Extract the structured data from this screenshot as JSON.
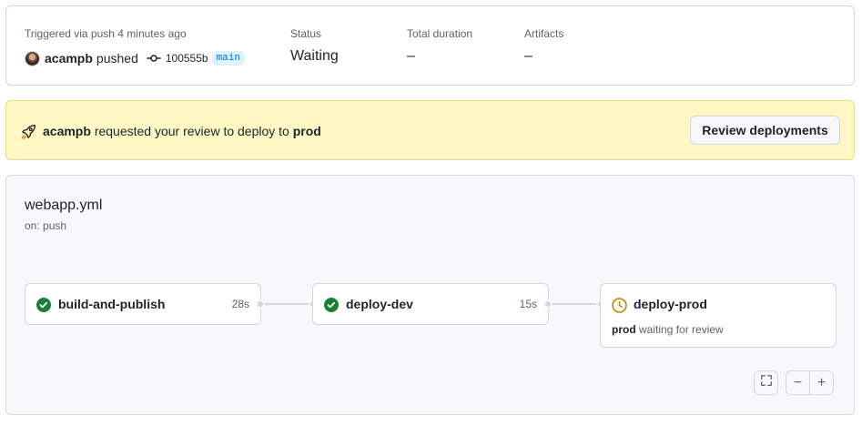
{
  "summary": {
    "trigger_label": "Triggered via push 4 minutes ago",
    "actor": "acampb",
    "action": "pushed",
    "commit_sha": "100555b",
    "branch": "main",
    "status_label": "Status",
    "status_value": "Waiting",
    "duration_label": "Total duration",
    "duration_value": "–",
    "artifacts_label": "Artifacts",
    "artifacts_value": "–"
  },
  "banner": {
    "actor": "acampb",
    "text_middle": "requested your review to deploy to",
    "environment": "prod",
    "button_label": "Review deployments",
    "icon": "rocket-icon"
  },
  "workflow": {
    "file": "webapp.yml",
    "trigger": "on: push",
    "jobs": [
      {
        "name": "build-and-publish",
        "duration": "28s",
        "status": "success",
        "icon": "check-circle-icon"
      },
      {
        "name": "deploy-dev",
        "duration": "15s",
        "status": "success",
        "icon": "check-circle-icon"
      },
      {
        "name": "deploy-prod",
        "duration": "",
        "status": "waiting",
        "icon": "clock-icon",
        "sub_env": "prod",
        "sub_text": "waiting for review"
      }
    ],
    "controls": {
      "fullscreen": "fullscreen-icon",
      "zoom_out": "−",
      "zoom_in": "+"
    }
  },
  "colors": {
    "success": "#1a7f37",
    "waiting": "#bf8700",
    "banner_bg": "#fff8c5",
    "link": "#0969da"
  }
}
